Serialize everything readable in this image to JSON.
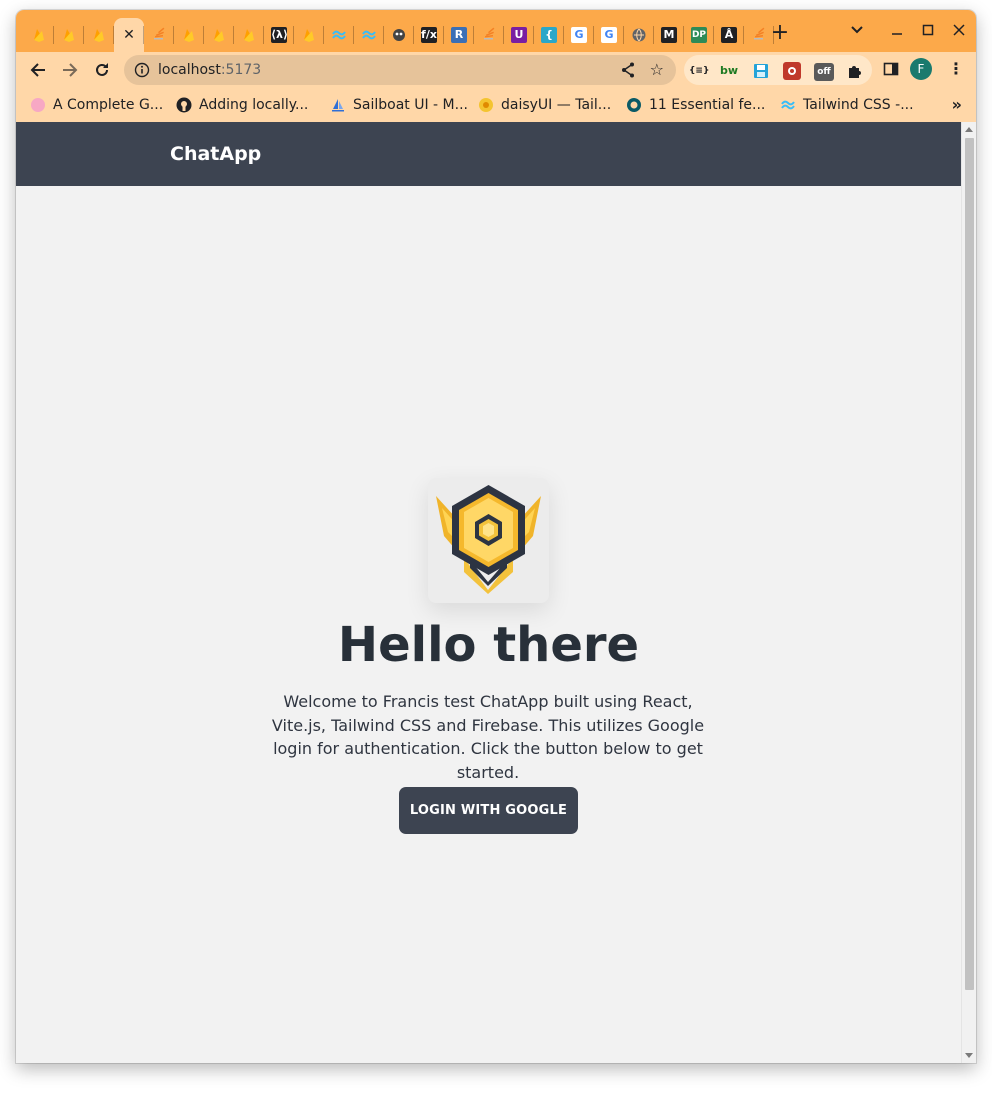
{
  "browser": {
    "tabs": [
      {
        "icon": "firebase-icon",
        "active": false
      },
      {
        "icon": "firebase-icon",
        "active": false
      },
      {
        "icon": "firebase-icon",
        "active": false
      },
      {
        "icon": "close-icon",
        "active": true
      },
      {
        "icon": "stackoverflow-icon",
        "active": false
      },
      {
        "icon": "firebase-icon",
        "active": false
      },
      {
        "icon": "firebase-icon",
        "active": false
      },
      {
        "icon": "firebase-icon",
        "active": false
      },
      {
        "icon": "code-icon",
        "active": false
      },
      {
        "icon": "firebase-icon",
        "active": false
      },
      {
        "icon": "tailwind-icon",
        "active": false
      },
      {
        "icon": "tailwind-icon",
        "active": false
      },
      {
        "icon": "bug-icon",
        "active": false
      },
      {
        "icon": "fx-icon",
        "active": false
      },
      {
        "icon": "r-icon",
        "active": false
      },
      {
        "icon": "stackoverflow-icon",
        "active": false
      },
      {
        "icon": "u-icon",
        "active": false
      },
      {
        "icon": "bracket-icon",
        "active": false
      },
      {
        "icon": "google-icon",
        "active": false
      },
      {
        "icon": "google-icon",
        "active": false
      },
      {
        "icon": "globe-icon",
        "active": false
      },
      {
        "icon": "m-icon",
        "active": false
      },
      {
        "icon": "dp-icon",
        "active": false
      },
      {
        "icon": "tower-icon",
        "active": false
      },
      {
        "icon": "stackoverflow-icon",
        "active": false
      }
    ],
    "tab_text": {
      "code": "⟨λ⟩",
      "fx": "f/x",
      "r": "R",
      "u": "U",
      "bracket": "{",
      "google": "G",
      "m": "M",
      "dp": "DP",
      "tower": "Å"
    },
    "url_host": "localhost",
    "url_port": ":5173",
    "extensions": {
      "json": "{≡}",
      "bw": "bw",
      "off": "off"
    },
    "profile_initial": "F",
    "bookmarks": [
      {
        "label": "A Complete G...",
        "icon": "pink-dot-icon"
      },
      {
        "label": "Adding locally...",
        "icon": "github-icon"
      },
      {
        "label": "Sailboat UI - M...",
        "icon": "sailboat-icon"
      },
      {
        "label": "daisyUI — Tail...",
        "icon": "daisy-icon"
      },
      {
        "label": "11 Essential fe...",
        "icon": "eleven-icon"
      },
      {
        "label": "Tailwind CSS -...",
        "icon": "tailwind-icon"
      }
    ],
    "more_bookmarks": "»",
    "colors": {
      "tab_strip": "#fca94a",
      "toolbar": "#ffd7a8",
      "omnibox": "#e6c39a"
    }
  },
  "app": {
    "brand": "ChatApp",
    "hero_title": "Hello there",
    "hero_description": "Welcome to Francis test ChatApp built using React, Vite.js, Tailwind CSS and Firebase. This utilizes Google login for authentication. Click the button below to get started.",
    "login_button": "LOGIN WITH GOOGLE",
    "logo_icon": "gold-badge-icon",
    "colors": {
      "navbar": "#3d4451",
      "page_bg": "#f2f2f2",
      "button": "#3d4451",
      "title": "#283039"
    }
  }
}
